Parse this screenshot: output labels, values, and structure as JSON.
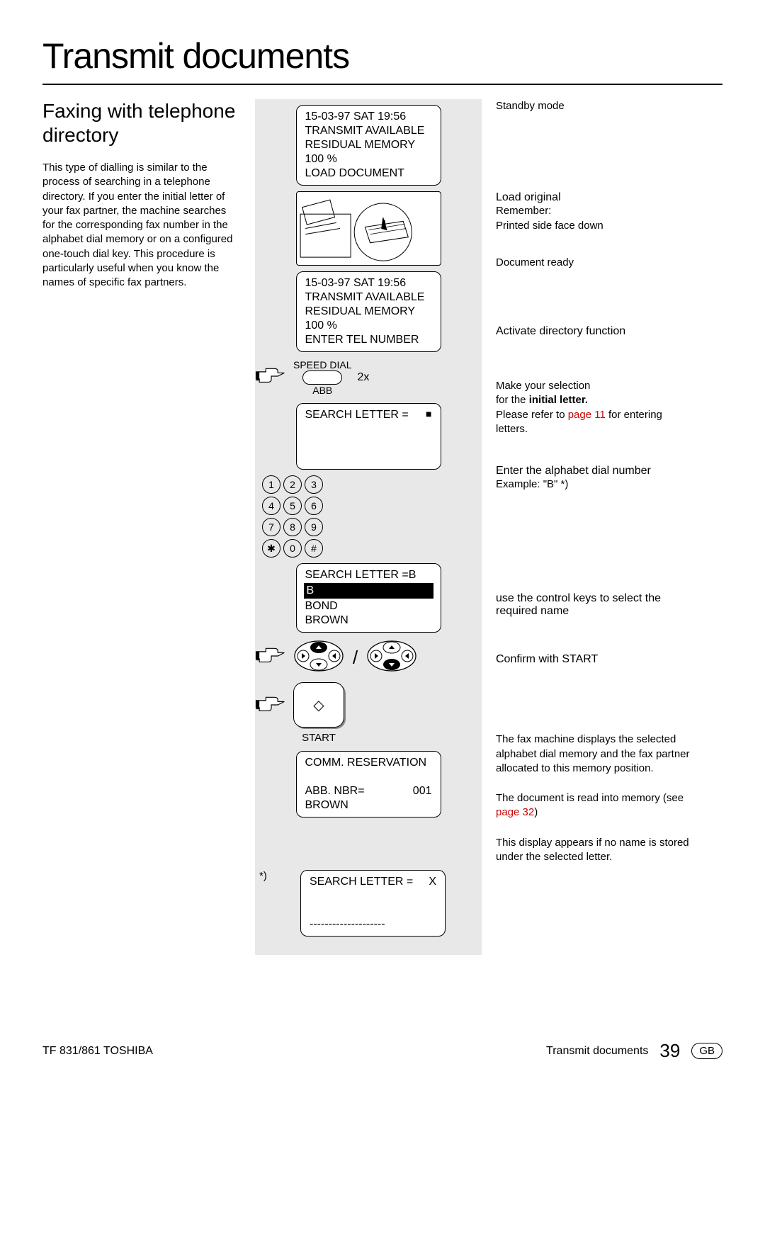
{
  "pageTitle": "Transmit documents",
  "left": {
    "sectionTitle": "Faxing with telephone directory",
    "body": "This type of dialling is similar to the process of searching in a telephone directory. If you enter the initial letter of your fax partner, the machine searches for the corresponding fax number in the alphabet dial memory or on a configured one-touch dial key. This procedure is particularly useful when you know the names of specific fax partners."
  },
  "mid": {
    "lcd1": {
      "l1": "15-03-97    SAT    19:56",
      "l2": "TRANSMIT AVAILABLE",
      "l3": "RESIDUAL MEMORY 100 %",
      "l4": "LOAD DOCUMENT"
    },
    "lcd2": {
      "l1": "15-03-97    SAT    19:56",
      "l2": "TRANSMIT AVAILABLE",
      "l3": "RESIDUAL MEMORY 100 %",
      "l4": "ENTER TEL NUMBER"
    },
    "speed": {
      "top": "SPEED DIAL",
      "bottom": "ABB",
      "times": "2x"
    },
    "lcd3": {
      "l1": "SEARCH LETTER =",
      "sq": "■"
    },
    "keypad": [
      [
        "1",
        "2",
        "3"
      ],
      [
        "4",
        "5",
        "6"
      ],
      [
        "7",
        "8",
        "9"
      ],
      [
        "✱",
        "0",
        "#"
      ]
    ],
    "lcd4": {
      "l1": "SEARCH LETTER =B",
      "hl": "B",
      "l3": "BOND",
      "l4": "BROWN"
    },
    "startLabel": "START",
    "lcd5": {
      "l1": "COMM. RESERVATION",
      "l3a": "ABB. NBR=",
      "l3b": "001",
      "l4": "BROWN"
    },
    "footnoteMark": "*)",
    "lcd6": {
      "l1a": "SEARCH LETTER =",
      "l1b": "X",
      "dashes": "--------------------"
    }
  },
  "right": {
    "standby": "Standby mode",
    "load": {
      "h": "Load original",
      "r1": "Remember:",
      "r2": "Printed side face down"
    },
    "docReady": "Document ready",
    "activate": "Activate directory function",
    "select": {
      "p1": "Make your selection",
      "p2a": "for the ",
      "p2b": "initial letter.",
      "p3a": "Please refer to ",
      "p3b": "page 11",
      "p3c": " for entering letters."
    },
    "enter": {
      "h": "Enter the alphabet dial number",
      "ex": "Example: \"B\" *)"
    },
    "control": "use the control keys to select the required name",
    "confirm": "Confirm with START",
    "result1": "The fax machine displays the selected alphabet dial memory and the fax partner allocated to this memory position.",
    "result2a": "The document is read into memory (see ",
    "result2b": "page 32",
    "result2c": ")",
    "noName": "This display appears if no name is stored under the selected letter."
  },
  "footer": {
    "left": "TF 831/861 TOSHIBA",
    "rightLabel": "Transmit documents",
    "page": "39",
    "lang": "GB"
  }
}
